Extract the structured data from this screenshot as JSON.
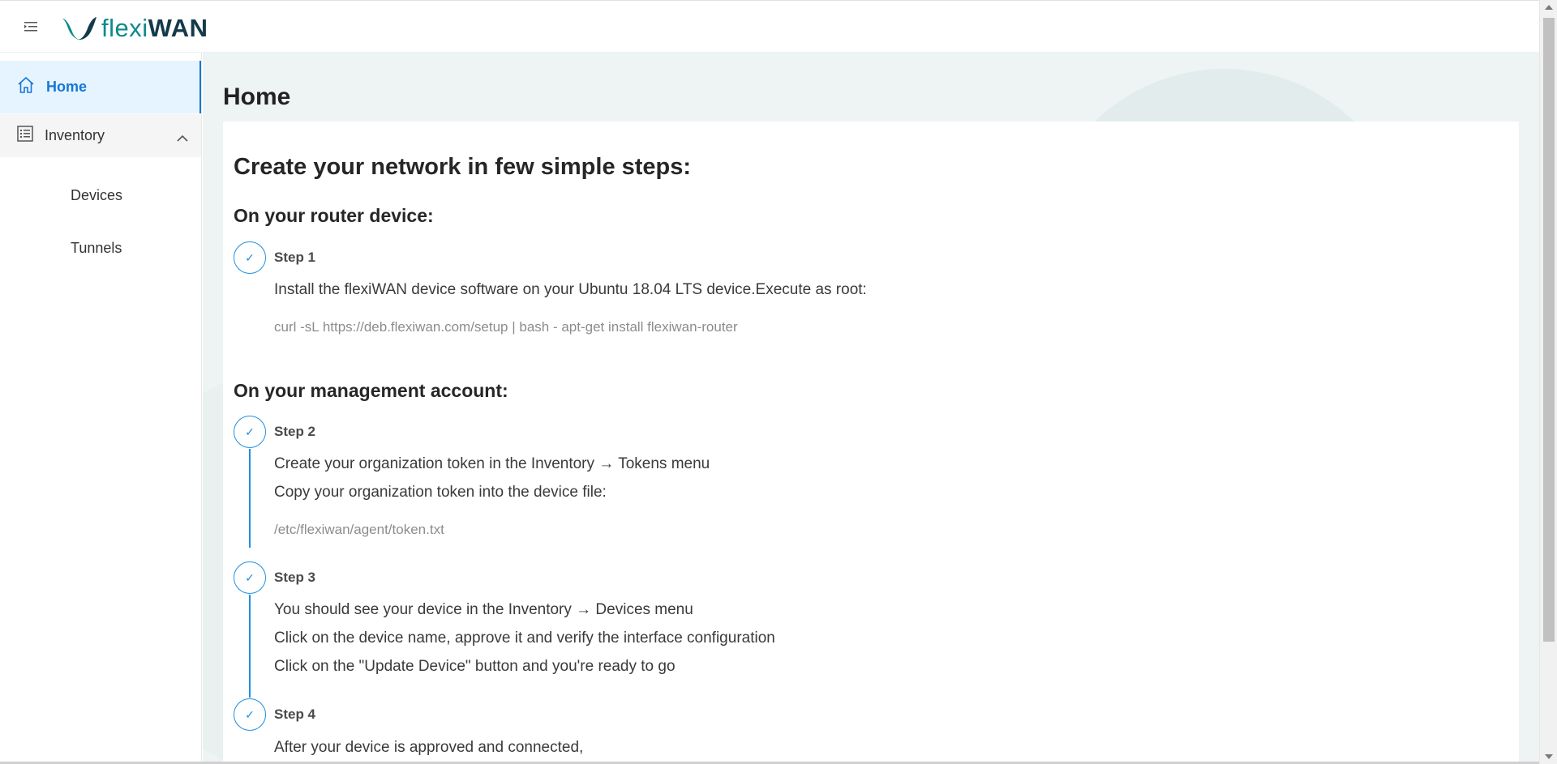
{
  "header": {
    "menu_icon": "menu-fold-icon",
    "logo_part1": "flexi",
    "logo_part2": "WAN"
  },
  "sidebar": {
    "items": [
      {
        "label": "Home",
        "icon": "home-icon",
        "active": true
      },
      {
        "label": "Inventory",
        "icon": "inventory-icon",
        "expanded": true
      },
      {
        "label": "Devices"
      },
      {
        "label": "Tunnels"
      }
    ]
  },
  "main": {
    "page_title": "Home",
    "card_title": "Create your network in few simple steps:",
    "section_router": "On your router device:",
    "section_management": "On your management account:",
    "steps": [
      {
        "label": "Step 1",
        "lines": [
          "Install the flexiWAN device software on your Ubuntu 18.04 LTS device.Execute as root:"
        ],
        "code": "curl -sL https://deb.flexiwan.com/setup | bash - apt-get install flexiwan-router"
      },
      {
        "label": "Step 2",
        "lines": [
          "Create your organization token in the Inventory → Tokens menu",
          "Copy your organization token into the device file:"
        ],
        "code": "/etc/flexiwan/agent/token.txt"
      },
      {
        "label": "Step 3",
        "lines": [
          "You should see your device in the Inventory → Devices menu",
          "Click on the device name, approve it and verify the interface configuration",
          "Click on the \"Update Device\" button and you're ready to go"
        ]
      },
      {
        "label": "Step 4",
        "lines": [
          "After your device is approved and connected,"
        ]
      }
    ]
  },
  "colors": {
    "accent": "#1677d6",
    "step_blue": "#1f8fe0",
    "logo_teal": "#0f8a8a",
    "logo_navy": "#143a4a",
    "content_bg": "#eef4f4"
  }
}
